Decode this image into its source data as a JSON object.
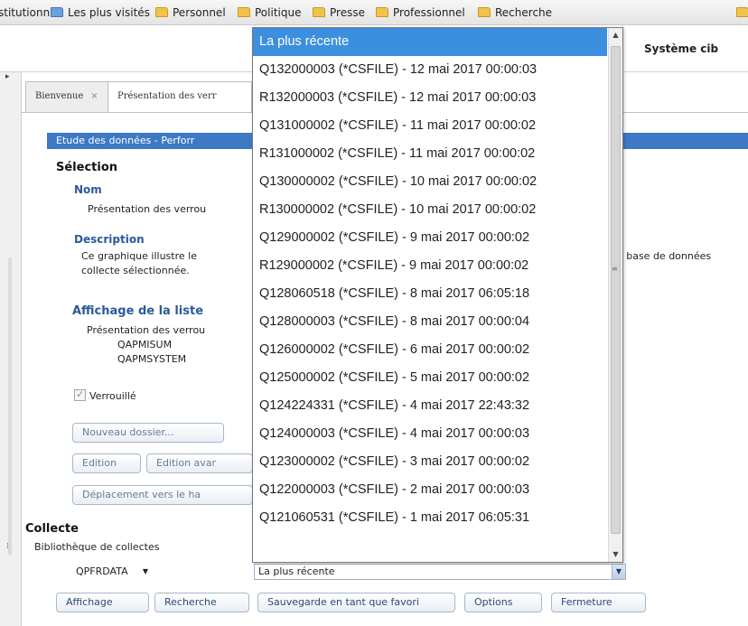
{
  "bookmarks": [
    {
      "label": "stitutionnel"
    },
    {
      "label": "Les plus visités"
    },
    {
      "label": "Personnel"
    },
    {
      "label": "Politique"
    },
    {
      "label": "Presse"
    },
    {
      "label": "Professionnel"
    },
    {
      "label": "Recherche"
    }
  ],
  "system": {
    "label": "Système cib"
  },
  "tabs": [
    {
      "label": "Bienvenue",
      "close": "×"
    },
    {
      "label": "Présentation des verr"
    }
  ],
  "panel": {
    "title": "Etude des données - Perforr",
    "selection_heading": "Sélection",
    "name_heading": "Nom",
    "name_value": "Présentation des verrou",
    "description_heading": "Description",
    "description_line1": "Ce graphique illustre le",
    "description_line2": "collecte sélectionnée.",
    "description_tail": "s base de données",
    "list_heading": "Affichage de la liste",
    "list_line1": "Présentation des verrou",
    "list_line2": "QAPMISUM",
    "list_line3": "QAPMSYSTEM",
    "checkbox_label": "Verrouillé",
    "btn_new_folder": "Nouveau dossier...",
    "btn_edit": "Edition",
    "btn_edit_adv": "Edition avar",
    "btn_move": "Déplacement vers le ha",
    "collecte_heading": "Collecte",
    "library_label": "Bibliothèque de collectes",
    "library_value": "QPFRDATA",
    "collection_value": "La plus récente",
    "buttons": {
      "display": "Affichage",
      "search": "Recherche",
      "save_favorite": "Sauvegarde en tant que favori",
      "options": "Options",
      "close": "Fermeture"
    }
  },
  "dropdown": {
    "items": [
      "La plus récente",
      "Q132000003 (*CSFILE) - 12 mai 2017 00:00:03",
      "R132000003 (*CSFILE) - 12 mai 2017 00:00:03",
      "Q131000002 (*CSFILE) - 11 mai 2017 00:00:02",
      "R131000002 (*CSFILE) - 11 mai 2017 00:00:02",
      "Q130000002 (*CSFILE) - 10 mai 2017 00:00:02",
      "R130000002 (*CSFILE) - 10 mai 2017 00:00:02",
      "Q129000002 (*CSFILE) - 9 mai 2017 00:00:02",
      "R129000002 (*CSFILE) - 9 mai 2017 00:00:02",
      "Q128060518 (*CSFILE) - 8 mai 2017 06:05:18",
      "Q128000003 (*CSFILE) - 8 mai 2017 00:00:04",
      "Q126000002 (*CSFILE) - 6 mai 2017 00:00:02",
      "Q125000002 (*CSFILE) - 5 mai 2017 00:00:02",
      "Q124224331 (*CSFILE) - 4 mai 2017 22:43:32",
      "Q124000003 (*CSFILE) - 4 mai 2017 00:00:03",
      "Q123000002 (*CSFILE) - 3 mai 2017 00:00:02",
      "Q122000003 (*CSFILE) - 2 mai 2017 00:00:03",
      "Q121060531 (*CSFILE) - 1 mai 2017 06:05:31"
    ],
    "selected_index": 0
  }
}
